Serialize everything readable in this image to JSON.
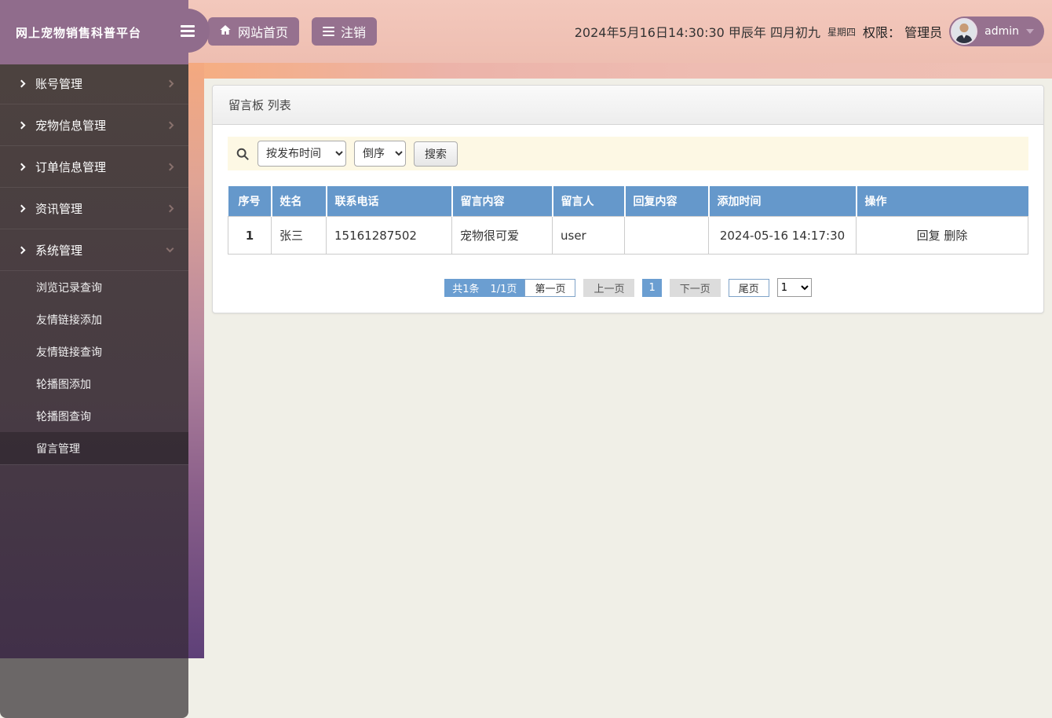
{
  "app": {
    "title": "网上宠物销售科普平台"
  },
  "header": {
    "home_button": "网站首页",
    "logout_button": "注销",
    "datetime": "2024年5月16日14:30:30 甲辰年 四月初九",
    "weekday": "星期四",
    "permission_text": "权限： 管理员",
    "username": "admin"
  },
  "sidebar": {
    "items": [
      {
        "label": "账号管理"
      },
      {
        "label": "宠物信息管理"
      },
      {
        "label": "订单信息管理"
      },
      {
        "label": "资讯管理"
      },
      {
        "label": "系统管理"
      }
    ],
    "submenu": [
      {
        "label": "浏览记录查询"
      },
      {
        "label": "友情链接添加"
      },
      {
        "label": "友情链接查询"
      },
      {
        "label": "轮播图添加"
      },
      {
        "label": "轮播图查询"
      },
      {
        "label": "留言管理"
      }
    ],
    "active_submenu": "留言管理"
  },
  "main": {
    "card_title": "留言板 列表",
    "search": {
      "sort_field_selected": "按发布时间",
      "sort_order_selected": "倒序",
      "search_button": "搜索"
    },
    "table": {
      "headers": [
        "序号",
        "姓名",
        "联系电话",
        "留言内容",
        "留言人",
        "回复内容",
        "添加时间",
        "操作"
      ],
      "rows": [
        {
          "index": "1",
          "name": "张三",
          "phone": "15161287502",
          "content": "宠物很可爱",
          "user": "user",
          "reply": "",
          "added_time": "2024-05-16 14:17:30",
          "actions": [
            "回复",
            "删除"
          ]
        }
      ]
    },
    "pagination": {
      "total_info": "共1条",
      "page_info": "1/1页",
      "first": "第一页",
      "prev": "上一页",
      "current": "1",
      "next": "下一页",
      "last": "尾页",
      "page_select": "1"
    }
  },
  "icons": {
    "toggle": "hamburger-icon",
    "home": "home-icon",
    "logout": "list-icon",
    "search": "magnifier-icon",
    "nav_expand": "chevron-icon",
    "user_menu": "caret-down-icon"
  },
  "colors": {
    "brand_purple": "#96718f",
    "logo_purple": "#906c8c",
    "header_pink": "#f0c2b5",
    "sidebar_dark": "#483c43",
    "sidebar_footer_gray": "#6b6767",
    "table_header_blue": "#6598cb",
    "pagination_blue": "#6b9ed1",
    "search_bar_cream": "#fdf8e4",
    "content_bg": "#f0efe7"
  }
}
